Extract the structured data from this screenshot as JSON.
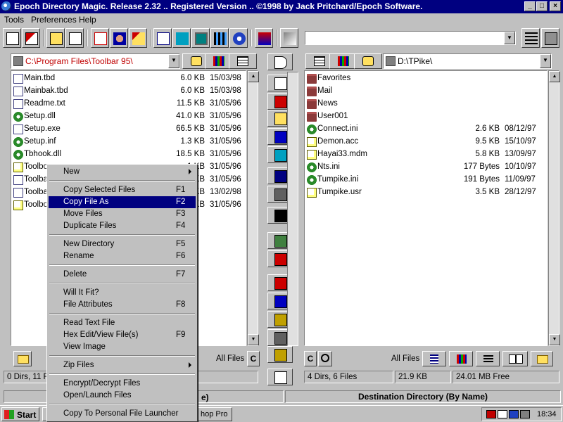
{
  "window": {
    "title": "Epoch Directory Magic. Release 2.32 .. Registered Version .. ©1998 by Jack Pritchard/Epoch Software."
  },
  "menu": [
    "Tools",
    "Preferences",
    "Help"
  ],
  "toolbar_icons": [
    "check-icon",
    "spell-icon",
    "copy-icon",
    "page-icon",
    "ms-dos-icon",
    "users-icon",
    "sweep-icon",
    "notepad-icon",
    "n-icon",
    "monitor-icon",
    "film-icon",
    "power-icon",
    "network-icon",
    "key-icon"
  ],
  "left": {
    "path": "C:\\Program Files\\Toolbar 95\\",
    "files": [
      {
        "name": "Main.tbd",
        "size": "6.0 KB",
        "date": "15/03/98",
        "icon": "file"
      },
      {
        "name": "Mainbak.tbd",
        "size": "6.0 KB",
        "date": "15/03/98",
        "icon": "file"
      },
      {
        "name": "Readme.txt",
        "size": "11.5 KB",
        "date": "31/05/96",
        "icon": "file"
      },
      {
        "name": "Setup.dll",
        "size": "41.0 KB",
        "date": "31/05/96",
        "icon": "gear"
      },
      {
        "name": "Setup.exe",
        "size": "66.5 KB",
        "date": "31/05/96",
        "icon": "file"
      },
      {
        "name": "Setup.inf",
        "size": "1.3 KB",
        "date": "31/05/96",
        "icon": "gear"
      },
      {
        "name": "Tbhook.dll",
        "size": "18.5 KB",
        "date": "31/05/96",
        "icon": "gear"
      },
      {
        "name": "Toolbo",
        "size": ".1 KB",
        "date": "31/05/96",
        "icon": "doc"
      },
      {
        "name": "Toolba",
        "size": "5 KB",
        "date": "31/05/96",
        "icon": "file"
      },
      {
        "name": "Toolba",
        "size": "6 KB",
        "date": "13/02/98",
        "icon": "file"
      },
      {
        "name": "Toolbo",
        "size": "2 KB",
        "date": "31/05/96",
        "icon": "doc"
      }
    ],
    "filter": "All Files",
    "status": [
      "0 Dirs, 11 Fi"
    ]
  },
  "right": {
    "path": "D:\\TPike\\",
    "files": [
      {
        "name": "Favorites",
        "size": "",
        "date": "",
        "icon": "folder"
      },
      {
        "name": "Mail",
        "size": "",
        "date": "",
        "icon": "folder"
      },
      {
        "name": "News",
        "size": "",
        "date": "",
        "icon": "folder"
      },
      {
        "name": "User001",
        "size": "",
        "date": "",
        "icon": "folder"
      },
      {
        "name": "Connect.ini",
        "size": "2.6 KB",
        "date": "08/12/97",
        "icon": "gear"
      },
      {
        "name": "Demon.acc",
        "size": "9.5 KB",
        "date": "15/10/97",
        "icon": "doc"
      },
      {
        "name": "Hayai33.mdm",
        "size": "5.8 KB",
        "date": "13/09/97",
        "icon": "doc"
      },
      {
        "name": "Nts.ini",
        "size": "177 Bytes",
        "date": "10/10/97",
        "icon": "gear"
      },
      {
        "name": "Tumpike.ini",
        "size": "191 Bytes",
        "date": "11/09/97",
        "icon": "gear"
      },
      {
        "name": "Tumpike.usr",
        "size": "3.5 KB",
        "date": "28/12/97",
        "icon": "doc"
      }
    ],
    "filter": "All Files",
    "status": [
      "4 Dirs, 6 Files",
      "21.9 KB",
      "24.01 MB Free"
    ]
  },
  "captions": {
    "left_partial": "e)",
    "right": "Destination Directory (By Name)"
  },
  "context_menu": [
    {
      "label": "New",
      "key": "",
      "submenu": true
    },
    {
      "sep": true
    },
    {
      "label": "Copy Selected Files",
      "key": "F1"
    },
    {
      "label": "Copy File As",
      "key": "F2",
      "selected": true
    },
    {
      "label": "Move Files",
      "key": "F3"
    },
    {
      "label": "Duplicate Files",
      "key": "F4"
    },
    {
      "sep": true
    },
    {
      "label": "New Directory",
      "key": "F5"
    },
    {
      "label": "Rename",
      "key": "F6"
    },
    {
      "sep": true
    },
    {
      "label": "Delete",
      "key": "F7"
    },
    {
      "sep": true
    },
    {
      "label": "Will It Fit?",
      "key": ""
    },
    {
      "label": "File Attributes",
      "key": "F8"
    },
    {
      "sep": true
    },
    {
      "label": "Read Text File",
      "key": ""
    },
    {
      "label": "Hex Edit/View File(s)",
      "key": "F9"
    },
    {
      "label": "View Image",
      "key": ""
    },
    {
      "sep": true
    },
    {
      "label": "Zip Files",
      "key": "",
      "submenu": true
    },
    {
      "sep": true
    },
    {
      "label": "Encrypt/Decrypt Files",
      "key": ""
    },
    {
      "label": "Open/Launch Files",
      "key": ""
    },
    {
      "sep": true
    },
    {
      "label": "Copy To Personal File Launcher",
      "key": ""
    }
  ],
  "taskbar": {
    "start": "Start",
    "task_partial": "hop Pro",
    "clock": "18:34"
  }
}
